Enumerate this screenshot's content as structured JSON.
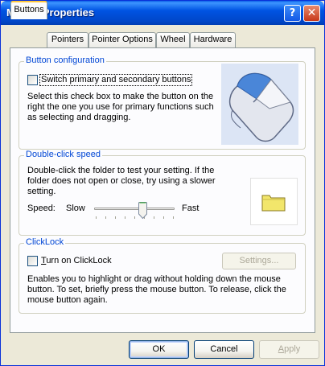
{
  "window": {
    "title": "Mouse Properties",
    "help_glyph": "?",
    "close_glyph": "✕"
  },
  "tabs": [
    {
      "label": "Buttons",
      "active": true
    },
    {
      "label": "Pointers"
    },
    {
      "label": "Pointer Options"
    },
    {
      "label": "Wheel"
    },
    {
      "label": "Hardware"
    }
  ],
  "button_config": {
    "group_title": "Button configuration",
    "checkbox_label": "Switch primary and secondary buttons",
    "checked": false,
    "desc_lines": [
      "Select this check box to make the button on the",
      "right the one you use for primary functions such",
      "as selecting and dragging."
    ],
    "image_icon": "mouse-icon"
  },
  "double_click": {
    "group_title": "Double-click speed",
    "desc_lines": [
      "Double-click the folder to test your setting. If the",
      "folder does not open or close, try using a slower",
      "setting."
    ],
    "speed_label": "Speed:",
    "slow_label": "Slow",
    "fast_label": "Fast",
    "speed_value": 0.6,
    "folder_icon": "folder-icon"
  },
  "clicklock": {
    "group_title": "ClickLock",
    "checkbox_label_prefix": "",
    "checkbox_label_mnemonic": "T",
    "checkbox_label_rest": "urn on ClickLock",
    "checked": false,
    "settings_button": "Settings...",
    "desc_lines": [
      "Enables you to highlight or drag without holding down the mouse",
      "button. To set, briefly press the mouse button. To release, click the",
      "mouse button again."
    ]
  },
  "footer": {
    "ok": "OK",
    "cancel": "Cancel",
    "apply_mnemonic": "A",
    "apply_rest": "pply"
  },
  "colors": {
    "titlebar": "#0054E3",
    "group_title": "#0046D5",
    "dialog_bg": "#ECE9D8",
    "folder": "#F2E66B"
  }
}
